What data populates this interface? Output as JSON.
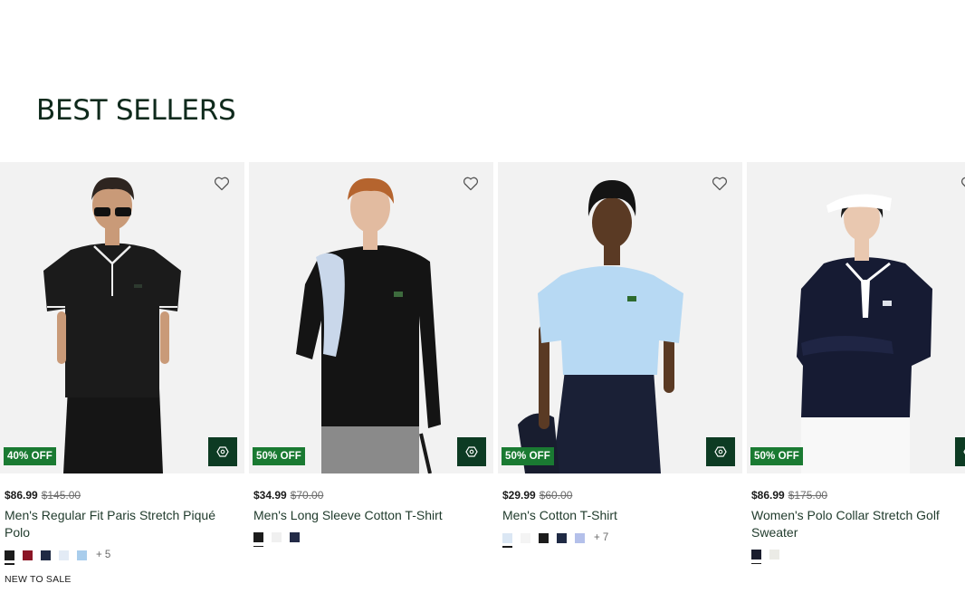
{
  "section": {
    "title": "BEST SELLERS"
  },
  "products": [
    {
      "name": "Men's Regular Fit Paris Stretch Piqué Polo",
      "price": "$86.99",
      "original_price": "$145.00",
      "discount": "40% OFF",
      "swatches": [
        "#1c1c1c",
        "#8b1525",
        "#1f2a44",
        "#e3ebf5",
        "#a9cdec"
      ],
      "more_colors": "+ 5",
      "tag": "NEW TO SALE"
    },
    {
      "name": "Men's Long Sleeve Cotton T-Shirt",
      "price": "$34.99",
      "original_price": "$70.00",
      "discount": "50% OFF",
      "swatches": [
        "#1c1c1c",
        "#f0f0f0",
        "#232b47"
      ],
      "more_colors": ""
    },
    {
      "name": "Men's Cotton T-Shirt",
      "price": "$29.99",
      "original_price": "$60.00",
      "discount": "50% OFF",
      "swatches": [
        "#dbe7f4",
        "#f4f4f4",
        "#1c1c1c",
        "#1f2a44",
        "#b4c0ea"
      ],
      "more_colors": "+ 7"
    },
    {
      "name": "Women's Polo Collar Stretch Golf Sweater",
      "price": "$86.99",
      "original_price": "$175.00",
      "discount": "50% OFF",
      "swatches": [
        "#1a1d2e",
        "#ebebe6"
      ],
      "more_colors": ""
    }
  ],
  "colors": {
    "accent_green": "#1a7a32",
    "dark_green": "#0d3b23",
    "title_green": "#0f2a1c"
  },
  "icons": {
    "wishlist": "heart-outline-icon",
    "try_on": "virtual-try-on-icon"
  }
}
